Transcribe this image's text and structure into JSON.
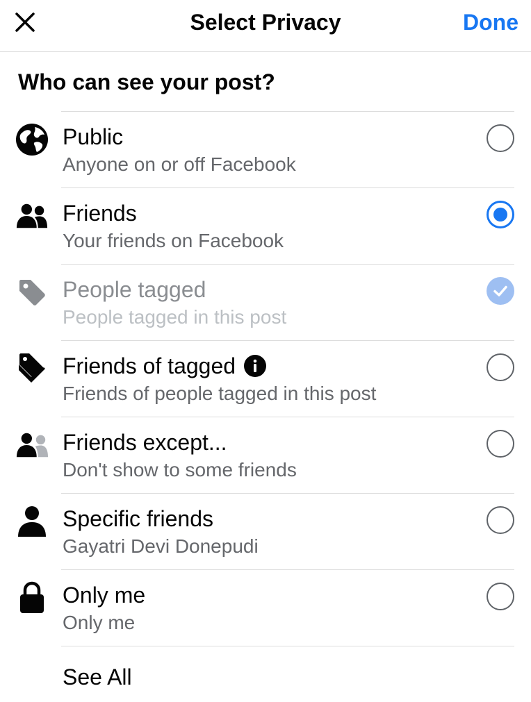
{
  "header": {
    "title": "Select Privacy",
    "done_label": "Done",
    "close_icon": "close-icon"
  },
  "question": "Who can see your post?",
  "options": [
    {
      "icon": "globe-icon",
      "title": "Public",
      "subtitle": "Anyone on or off Facebook",
      "state": "unselected"
    },
    {
      "icon": "friends-icon",
      "title": "Friends",
      "subtitle": "Your friends on Facebook",
      "state": "selected"
    },
    {
      "icon": "tag-icon",
      "title": "People tagged",
      "subtitle": "People tagged in this post",
      "state": "checked-disabled"
    },
    {
      "icon": "tags-stack-icon",
      "title": "Friends of tagged",
      "subtitle": "Friends of people tagged in this post",
      "state": "unselected",
      "info_icon": "info-icon"
    },
    {
      "icon": "friends-except-icon",
      "title": "Friends except...",
      "subtitle": "Don't show to some friends",
      "state": "unselected"
    },
    {
      "icon": "person-icon",
      "title": "Specific friends",
      "subtitle": "Gayatri Devi Donepudi",
      "state": "unselected"
    },
    {
      "icon": "lock-icon",
      "title": "Only me",
      "subtitle": "Only me",
      "state": "unselected"
    }
  ],
  "see_all_label": "See All",
  "colors": {
    "accent": "#1877f2",
    "checked_disabled": "#9ebff2",
    "secondary_text": "#65676b",
    "divider": "#dcdcdc"
  }
}
